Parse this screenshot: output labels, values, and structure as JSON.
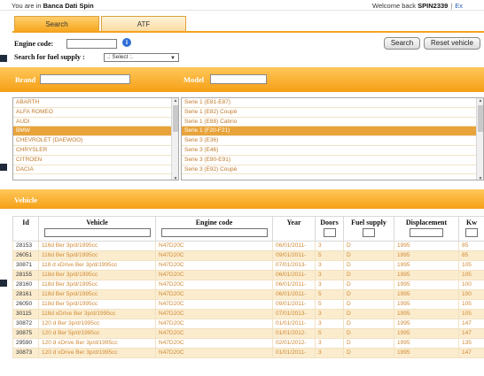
{
  "topbar": {
    "left_prefix": "You are in",
    "company": "Banca Dati Spin",
    "welcome": "Welcome back",
    "user": "SPIN2339",
    "exit": "Ex"
  },
  "tabs": [
    {
      "label": "Search",
      "active": true
    },
    {
      "label": "ATF",
      "active": false
    }
  ],
  "form": {
    "engine_code_label": "Engine code:",
    "engine_code_value": "",
    "fuel_label": "Search for fuel supply :",
    "fuel_selected": ".: Select :.",
    "search_button": "Search",
    "reset_button": "Reset vehicle"
  },
  "brand_bar": {
    "brand_label": "Brand",
    "model_label": "Model"
  },
  "brands": [
    "ABARTH",
    "ALFA ROMEO",
    "AUDI",
    "BMW",
    "CHEVROLET (DAEWOO)",
    "CHRYSLER",
    "CITROEN",
    "DACIA"
  ],
  "selected_brand_index": 3,
  "models": [
    "Serie 1 (E81-E87)",
    "Serie 1 (E82) Coupè",
    "Serie 1 (E88) Cabrio",
    "Serie 1 (F20-F21)",
    "Serie 3 (E36)",
    "Serie 3 (E46)",
    "Serie 3 (E90-E91)",
    "Serie 3 (E92) Coupè"
  ],
  "selected_model_index": 3,
  "vehicle_bar": {
    "label": "Vehicle"
  },
  "table": {
    "columns": [
      "Id",
      "Vehicle",
      "Engine code",
      "Year",
      "Doors",
      "Fuel supply",
      "Displacement",
      "Kw"
    ],
    "rows": [
      [
        "28153",
        "116d Ber 3p/d/1995cc",
        "N47D20C",
        "06/01/2011-",
        "3",
        "D",
        "1995",
        "85"
      ],
      [
        "26051",
        "116d Ber 5p/d/1995cc",
        "N47D20C",
        "09/01/2011-",
        "5",
        "D",
        "1995",
        "85"
      ],
      [
        "30871",
        "118 d xDrive Ber 3p/d/1995cc",
        "N47D20C",
        "07/01/2013-",
        "3",
        "D",
        "1995",
        "105"
      ],
      [
        "28155",
        "118d Ber 3p/d/1995cc",
        "N47D20C",
        "06/01/2011-",
        "3",
        "D",
        "1995",
        "105"
      ],
      [
        "28160",
        "118d Ber 3p/d/1995cc",
        "N47D20C",
        "06/01/2011-",
        "3",
        "D",
        "1995",
        "100"
      ],
      [
        "28161",
        "118d Ber 5p/d/1995cc",
        "N47D20C",
        "06/01/2011-",
        "5",
        "D",
        "1995",
        "100"
      ],
      [
        "26050",
        "118d Ber 5p/d/1995cc",
        "N47D20C",
        "09/01/2011-",
        "5",
        "D",
        "1995",
        "105"
      ],
      [
        "30115",
        "118d xDrive Ber 3p/d/1995cc",
        "N47D20C",
        "07/01/2013-",
        "3",
        "D",
        "1995",
        "105"
      ],
      [
        "30872",
        "120 d Ber 3p/d/1995cc",
        "N47D20C",
        "01/01/2011-",
        "3",
        "D",
        "1995",
        "147"
      ],
      [
        "30875",
        "120 d Ber 5p/d/1995cc",
        "N47D20C",
        "01/01/2012-",
        "5",
        "D",
        "1995",
        "147"
      ],
      [
        "29590",
        "120 d xDrive Ber 3p/d/1995cc",
        "N47D20C",
        "02/01/2012-",
        "3",
        "D",
        "1995",
        "135"
      ],
      [
        "30873",
        "120 d xDrive Ber 3p/d/1995cc",
        "N47D20C",
        "01/01/2011-",
        "3",
        "D",
        "1995",
        "147"
      ]
    ]
  },
  "colors": {
    "accent": "#f6a821",
    "link": "#c07a2a",
    "selected": "#e8a33a",
    "info": "#2f6fd6"
  }
}
